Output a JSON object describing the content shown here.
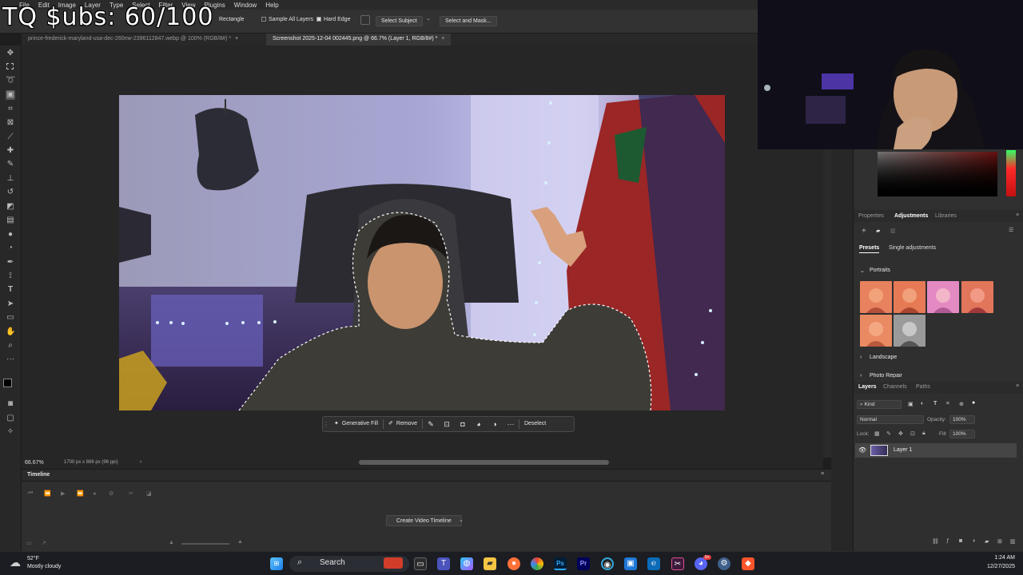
{
  "overlay": {
    "subs_text": "TQ $ubs: 60/100"
  },
  "menubar": {
    "items": [
      "File",
      "Edit",
      "Image",
      "Layer",
      "Type",
      "Select",
      "Filter",
      "View",
      "Plugins",
      "Window",
      "Help"
    ]
  },
  "options": {
    "mode": "Rectangle",
    "sample_all_layers": "Sample All Layers",
    "hard_edge": "Hard Edge",
    "select_subject": "Select Subject",
    "select_and_mask": "Select and Mask..."
  },
  "tabs": [
    {
      "label": "prince-frederick-maryland-usa-dec-260nw-2396112847.webp @ 100% (RGB/8#) *",
      "close": "×"
    },
    {
      "label": "Screenshot 2025-12-04 002445.png @ 66.7% (Layer 1, RGB/8#) *",
      "close": "×"
    }
  ],
  "contextbar": {
    "generative_fill": "Generative Fill",
    "remove": "Remove",
    "more": "···",
    "deselect": "Deselect"
  },
  "status": {
    "zoom": "66.67%",
    "doc_info": "1700 px x 886 px (96 ppi)",
    "arrow": "›"
  },
  "timeline": {
    "title": "Timeline",
    "create_button": "Create Video Timeline"
  },
  "panels": {
    "tabs": [
      "Properties",
      "Adjustments",
      "Libraries"
    ],
    "active_tab": "Adjustments",
    "subtabs": [
      "Presets",
      "Single adjustments"
    ],
    "groups": {
      "portraits": "Portraits",
      "landscape": "Landscape",
      "photo_repair": "Photo Repair"
    }
  },
  "layers": {
    "tabs": [
      "Layers",
      "Channels",
      "Paths"
    ],
    "filter": "Kind",
    "blend_mode": "Normal",
    "opacity_label": "Opacity:",
    "opacity": "100%",
    "lock_label": "Lock:",
    "fill_label": "Fill:",
    "fill": "100%",
    "layer_name": "Layer 1"
  },
  "taskbar": {
    "weather_temp": "52°F",
    "weather_desc": "Mostly cloudy",
    "search": "Search",
    "time": "1:24 AM",
    "date": "12/27/2025",
    "discord_badge": "9+"
  },
  "colors": {
    "accent": "#31a8ff",
    "foreground": "#000000",
    "background": "#ffffff"
  }
}
